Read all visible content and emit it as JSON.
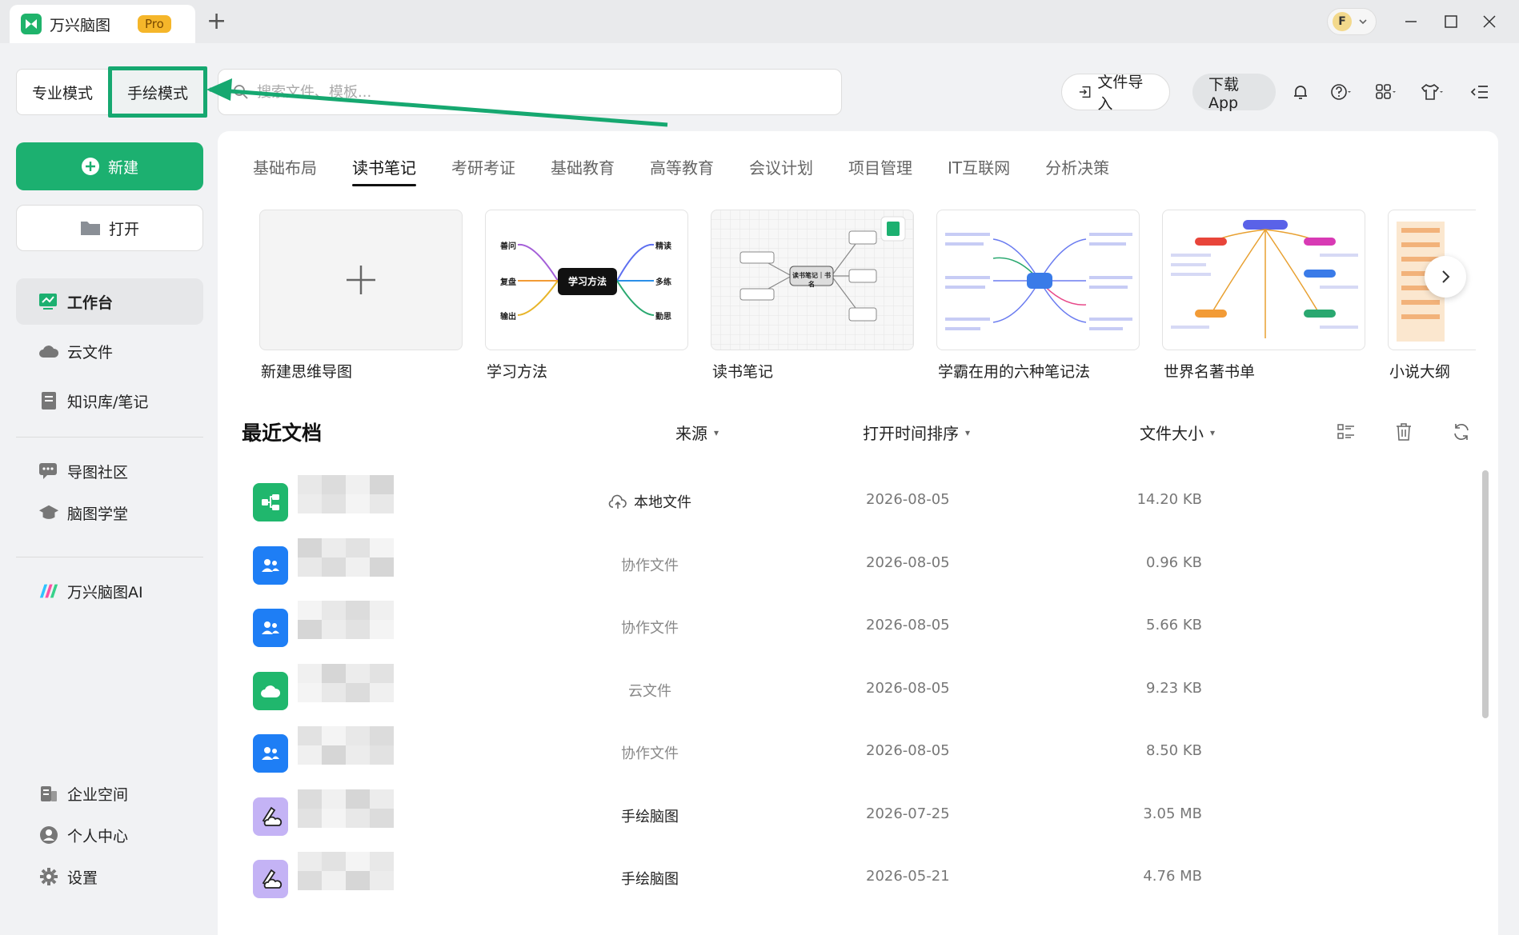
{
  "titlebar": {
    "app_name": "万兴脑图",
    "badge": "Pro",
    "new_tab": "+",
    "user_initial": "F"
  },
  "modes": {
    "pro": "专业模式",
    "hand": "手绘模式"
  },
  "search": {
    "placeholder": "搜索文件、模板..."
  },
  "toolbar": {
    "import": "文件导入",
    "download": "下载App"
  },
  "sidebar": {
    "new": "新建",
    "open": "打开",
    "items": [
      {
        "label": "工作台",
        "icon": "workbench-icon"
      },
      {
        "label": "云文件",
        "icon": "cloud-icon"
      },
      {
        "label": "知识库/笔记",
        "icon": "notebook-icon"
      },
      {
        "label": "导图社区",
        "icon": "community-icon"
      },
      {
        "label": "脑图学堂",
        "icon": "graduation-cap-icon"
      },
      {
        "label": "万兴脑图AI",
        "icon": "ai-logo-icon"
      },
      {
        "label": "企业空间",
        "icon": "building-icon"
      },
      {
        "label": "个人中心",
        "icon": "person-icon"
      },
      {
        "label": "设置",
        "icon": "gear-icon"
      }
    ]
  },
  "categories": [
    "基础布局",
    "读书笔记",
    "考研考证",
    "基础教育",
    "高等教育",
    "会议计划",
    "项目管理",
    "IT互联网",
    "分析决策"
  ],
  "templates": [
    {
      "label": "新建思维导图"
    },
    {
      "label": "学习方法",
      "center": "学习方法",
      "left": [
        "善问",
        "复盘",
        "输出"
      ],
      "right": [
        "精读",
        "多练",
        "勤思"
      ]
    },
    {
      "label": "读书笔记",
      "center": "读书笔记｜书名"
    },
    {
      "label": "学霸在用的六种笔记法"
    },
    {
      "label": "世界名著书单"
    },
    {
      "label": "小说大纲"
    }
  ],
  "recent": {
    "title": "最近文档",
    "col_source": "来源",
    "col_time": "打开时间排序",
    "col_size": "文件大小",
    "rows": [
      {
        "source": "本地文件",
        "date": "2026-08-05",
        "size": "14.20 KB",
        "type": "local"
      },
      {
        "source": "协作文件",
        "date": "2026-08-05",
        "size": "0.96 KB",
        "type": "collab"
      },
      {
        "source": "协作文件",
        "date": "2026-08-05",
        "size": "5.66 KB",
        "type": "collab"
      },
      {
        "source": "云文件",
        "date": "2026-08-05",
        "size": "9.23 KB",
        "type": "cloud"
      },
      {
        "source": "协作文件",
        "date": "2026-08-05",
        "size": "8.50 KB",
        "type": "collab"
      },
      {
        "source": "手绘脑图",
        "date": "2026-07-25",
        "size": "3.05 MB",
        "type": "hand"
      },
      {
        "source": "手绘脑图",
        "date": "2026-05-21",
        "size": "4.76 MB",
        "type": "hand"
      }
    ]
  },
  "colors": {
    "brand": "#1cb070",
    "highlight": "#16a870",
    "collab": "#1e7ef5"
  }
}
